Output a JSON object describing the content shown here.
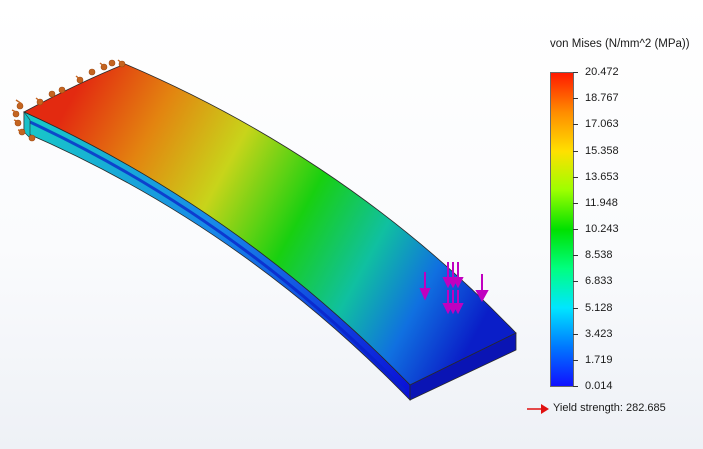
{
  "legend": {
    "title": "von Mises (N/mm^2 (MPa))",
    "ticks": [
      "20.472",
      "18.767",
      "17.063",
      "15.358",
      "13.653",
      "11.948",
      "10.243",
      "8.538",
      "6.833",
      "5.128",
      "3.423",
      "1.719",
      "0.014"
    ],
    "colormap": [
      "#ff1a00",
      "#ff8c00",
      "#ffe000",
      "#9cff00",
      "#00e000",
      "#00ff80",
      "#00e6ff",
      "#0078ff",
      "#1010ff"
    ]
  },
  "yield": {
    "label": "Yield strength: 282.685",
    "marker_color": "#e01010"
  },
  "model": {
    "fixture_icon": "fixture-arrow-icon",
    "load_icon": "force-arrow-icon",
    "load_color": "#c000c0",
    "fixture_color": "#c46420"
  }
}
